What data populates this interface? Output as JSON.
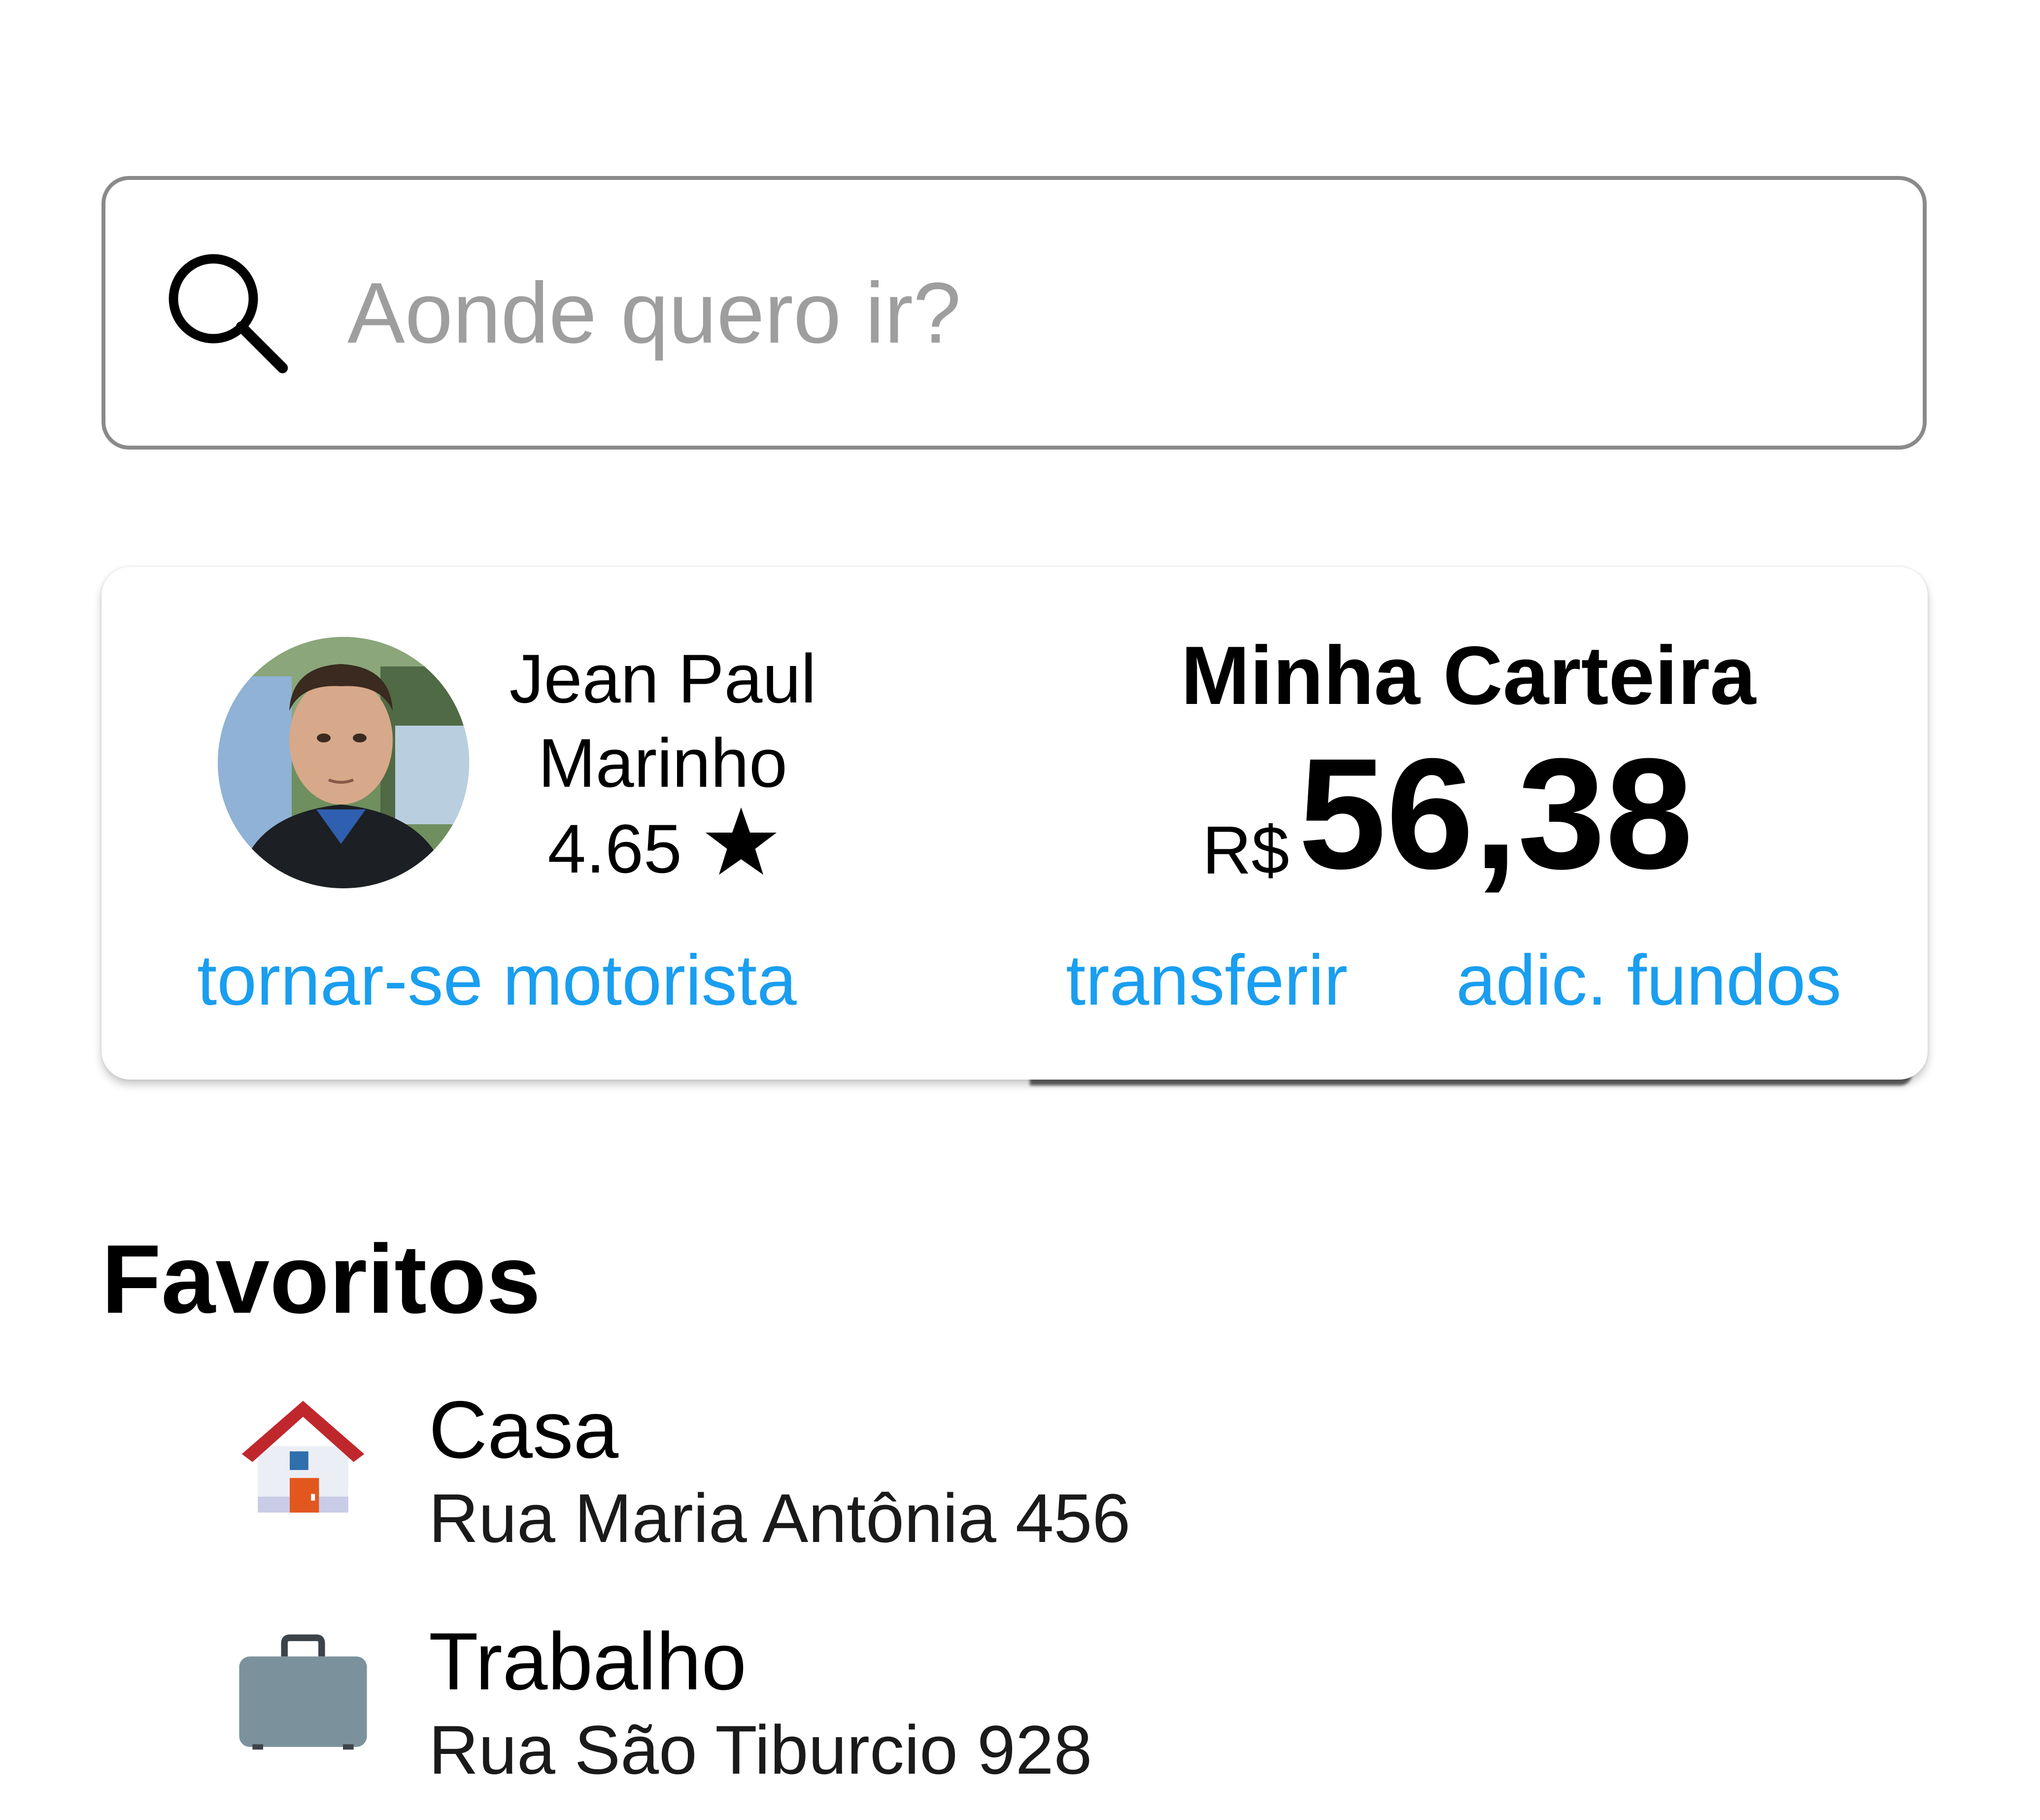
{
  "search": {
    "placeholder": "Aonde quero ir?",
    "value": "",
    "icon": "search-icon"
  },
  "profile": {
    "name_line1": "Jean Paul",
    "name_line2": "Marinho",
    "rating": "4.65",
    "rating_icon": "star-icon",
    "become_driver_label": "tornar-se motorista"
  },
  "wallet": {
    "title": "Minha Carteira",
    "currency": "R$",
    "balance": "56,38",
    "transfer_label": "transferir",
    "add_funds_label": "adic. fundos"
  },
  "favorites": {
    "title": "Favoritos",
    "items": [
      {
        "icon": "house-icon",
        "name": "Casa",
        "address": "Rua Maria Antônia 456"
      },
      {
        "icon": "briefcase-icon",
        "name": "Trabalho",
        "address": "Rua São Tiburcio 928"
      }
    ]
  },
  "colors": {
    "link": "#1a9ef0",
    "placeholder": "#9e9e9e",
    "border": "#8a8a8a"
  }
}
